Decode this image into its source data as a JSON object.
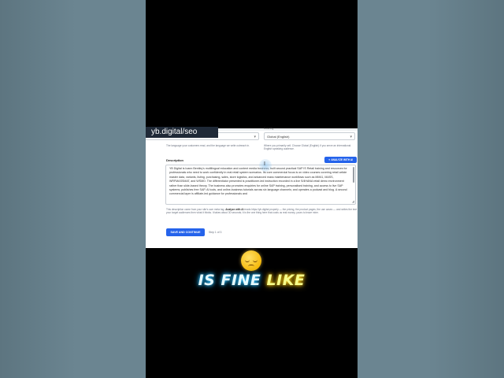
{
  "watermark": "yb.digital/seo",
  "form": {
    "language_select_value": "",
    "language_helper": "The language your customers read, and the language we write outreach in.",
    "country_label": "Country",
    "country_select_value": "Global (English)",
    "country_helper": "Where you primarily sell. Choose Global (English) if you serve an international English speaking audience.",
    "description_label": "Description",
    "analyze_button": "✦ ANALYZE WITH AI",
    "description_text": "YB Digital is Ioann Bentley's multilingual education and content media business, built around practical SAP IS Retail training and resources for professionals who need to work confidently in real retail system scenarios. Its core commercial focus is on video courses covering retail article master data, variants, listing, purchasing, sales, store logistics, and advanced mass maintenance workflows such as MM41, MASS, WRFMASSMAT, and WSMO. The differentiator presented is practitioner-led instruction recorded in a live S/4HANA retail demo environment rather than slide-based theory. The business also promotes enquiries for online SAP training, personalised training, and access to live SAP systems; publishes free SAP, AI tools, and online-business tutorials across six language channels; and operates a podcast and blog. A second commercial layer is affiliate-led guidance for professionals and",
    "description_helper_pre": "This description came from your site's own meta tag.",
    "description_helper_bold": "Analyze with AI",
    "description_helper_post": "reads https://yb.digital properly — the pricing, the product pages, the use cases — and writes the text your target audiences then what it thinks. It takes about 30 seconds; it is the one thing here that costs us real money, yours to leave mine.",
    "save_button": "SAVE AND CONTINUE",
    "step_text": "Step 1 of 3"
  },
  "caption": {
    "word1": "IS FINE",
    "word2": "LIKE"
  },
  "colors": {
    "primary": "#2563eb",
    "phone_bg": "#000000",
    "page_bg": "#6b8591"
  }
}
